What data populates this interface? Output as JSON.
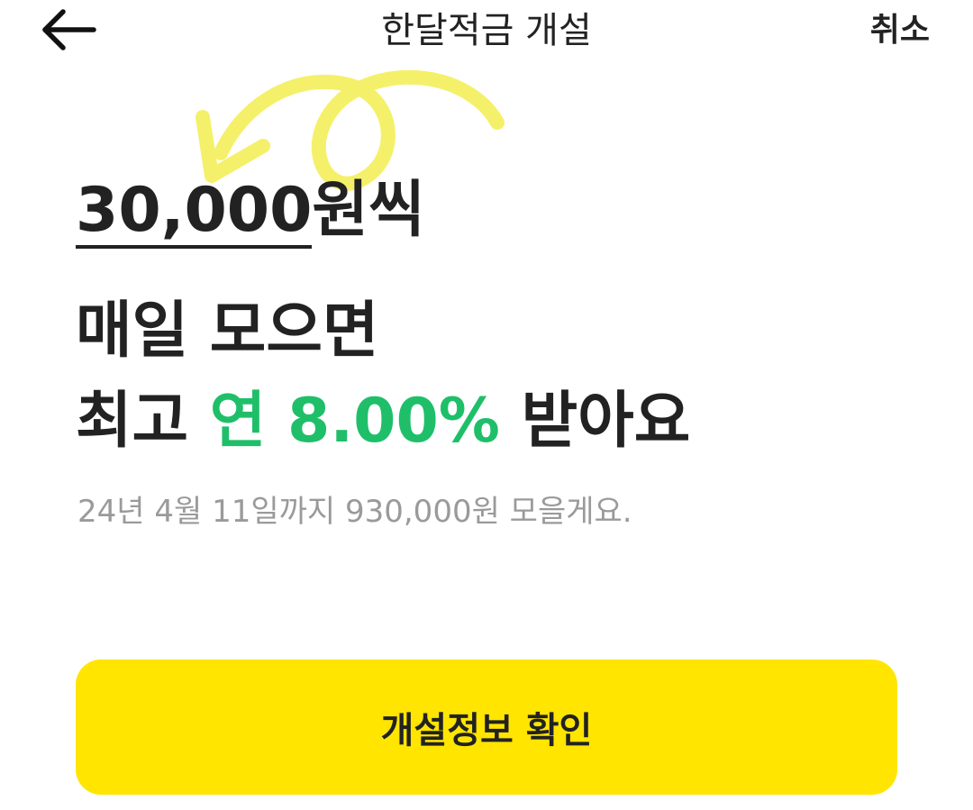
{
  "header": {
    "back_icon": "arrow-left-icon",
    "title": "한달적금 개설",
    "cancel_label": "취소"
  },
  "annotation": {
    "icon": "curved-arrow-doodle-icon",
    "color": "#f5f06a"
  },
  "main": {
    "amount_value": "30,000",
    "amount_suffix": "원씩",
    "line2": "매일 모으면",
    "line3_prefix": "최고 ",
    "line3_rate": "연 8.00%",
    "line3_suffix": " 받아요",
    "summary": "24년 4월 11일까지 930,000원 모을게요."
  },
  "footer": {
    "confirm_label": "개설정보 확인"
  },
  "colors": {
    "accent_yellow": "#ffe500",
    "rate_green": "#1fbf6a",
    "text_dark": "#222222",
    "text_muted": "#9a9a9a"
  }
}
